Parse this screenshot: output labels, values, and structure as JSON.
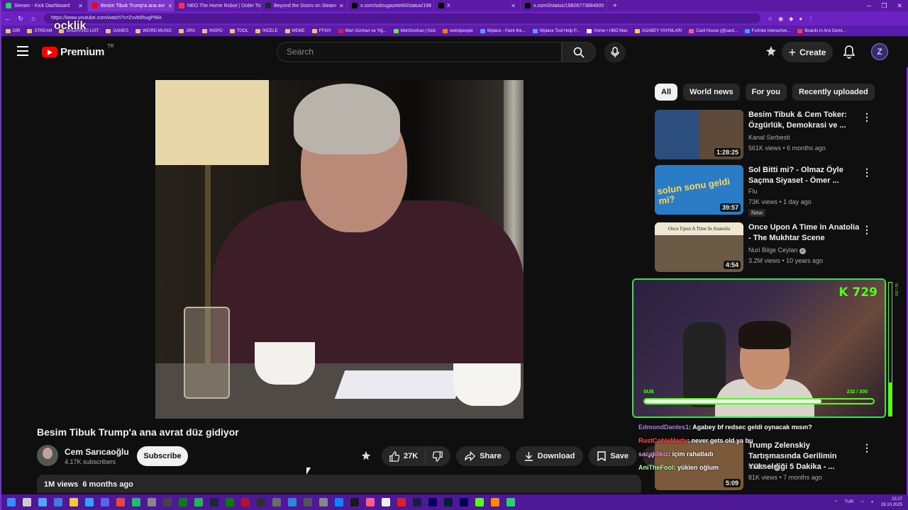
{
  "browser": {
    "tabs": [
      {
        "label": "Stream - Kick Dashboard",
        "active": false
      },
      {
        "label": "Besim Tibuk Trump'a ana avr",
        "active": true
      },
      {
        "label": "NEO The Home Robot | Order To",
        "active": false
      },
      {
        "label": "Beyond the Doors on Steam",
        "active": false
      },
      {
        "label": "x.com/solcugazete60/status/198",
        "active": false
      },
      {
        "label": "X",
        "active": false
      },
      {
        "label": "x.com/i/status/19828773884900",
        "active": false
      }
    ],
    "url": "https://www.youtube.com/watch?v=Zvvb6hugPWA",
    "bookmarks": [
      "DIR",
      "STREAM",
      "SHOPPING LIST",
      "GAMES",
      "WEIRD MUSIC",
      "JIRA",
      "INSPO",
      "TOOL",
      "İNCELE",
      "MEME",
      "FFXIV",
      "Mert Günhan ve Yiğ...",
      "MertGunhan | Kick",
      "weirdpeople",
      "Wplace - Paint the...",
      "Wplace Tool Help P...",
      "Home • HBO Max",
      "AGABEY YAYINLARI",
      "Card House (@card...",
      "Fortnite Interactive...",
      "Boards in Arvi Demi..."
    ]
  },
  "watermark": "ocklik",
  "header": {
    "logo_text": "Premium",
    "country_code": "TR",
    "search_placeholder": "Search",
    "create_label": "Create"
  },
  "video": {
    "title": "Besim Tibuk Trump'a ana avrat düz gidiyor",
    "channel": "Cem Sarıcaoğlu",
    "subscribers": "4.17K subscribers",
    "subscribe_label": "Subscribe",
    "likes": "27K",
    "share_label": "Share",
    "download_label": "Download",
    "save_label": "Save",
    "views": "1M views",
    "age": "6 months ago"
  },
  "chips": [
    "All",
    "World news",
    "For you",
    "Recently uploaded"
  ],
  "recommendations": [
    {
      "title": "Besim Tibuk & Cem Toker: Özgürlük, Demokrasi ve ...",
      "channel": "Kanal Serbesti",
      "meta": "561K views • 6 months ago",
      "duration": "1:28:25",
      "verified": false,
      "is_new": false,
      "thumb_color": "#2b4a7a"
    },
    {
      "title": "Sol Bitti mi? - Olmaz Öyle Saçma Siyaset - Ömer ...",
      "channel": "Flu",
      "meta": "73K views • 1 day ago",
      "duration": "39:57",
      "verified": false,
      "is_new": true,
      "thumb_color": "#1e6fb8",
      "thumb_text": "solun sonu geldi mi?"
    },
    {
      "title": "Once Upon A Time in Anatolia - The Mukhtar Scene",
      "channel": "Nuri Bilge Ceylan",
      "meta": "3.2M views • 10 years ago",
      "duration": "4:54",
      "verified": true,
      "is_new": false,
      "thumb_color": "#5a4a38",
      "thumb_text": "Once Upon A Time In Anatolia"
    },
    {
      "title": "Trump Zelenskiy Tartışmasında Gerilimin Yükseldiği 5 Dakika - ...",
      "channel": "CNBC-e",
      "meta": "81K views • 7 months ago",
      "duration": "5:09",
      "verified": true,
      "is_new": false,
      "thumb_color": "#7a5a3a"
    }
  ],
  "stream_overlay": {
    "viewer_badge": "K 729",
    "sub_label": "SUB",
    "sub_count": "232 / 300",
    "sub_progress": 0.7733,
    "side_label": "50 / 200"
  },
  "chat": [
    {
      "user": "EdmondDantes1",
      "user_color": "#b07bff",
      "text": ": Agabey bf redsec geldi oynacak mısın?"
    },
    {
      "user": "RustCohleMarty",
      "user_color": "#ff4d4d",
      "text": ": never gets old ya bu"
    },
    {
      "user": "sacaklikiz",
      "user_color": "#ff8ad6",
      "text": ": içim rahatladı"
    },
    {
      "user": "AniTheFool",
      "user_color": "#b7ffb0",
      "text": ": yüklen oğlum"
    }
  ],
  "taskbar": {
    "language": "TUR",
    "time": "23:27",
    "date": "28.10.2025"
  }
}
